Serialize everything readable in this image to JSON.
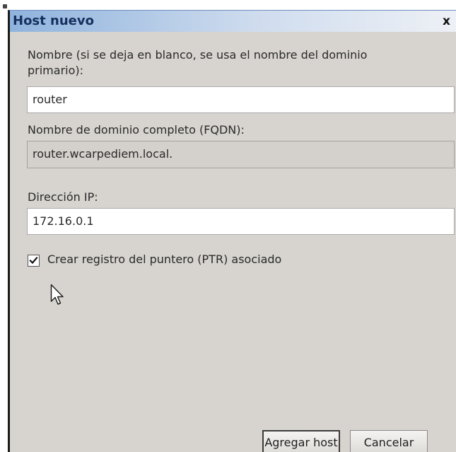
{
  "dialog": {
    "title": "Host nuevo",
    "close_label": "x"
  },
  "form": {
    "name_label": "Nombre (si se deja en blanco, se usa el nombre del dominio primario):",
    "name_label_line1": "Nombre (si se deja en blanco, se usa el nombre del dominio",
    "name_label_line2": "primario):",
    "name_value": "router",
    "fqdn_label": "Nombre de dominio completo (FQDN):",
    "fqdn_value": "router.wcarpediem.local.",
    "ip_label": "Dirección IP:",
    "ip_value": "172.16.0.1",
    "ptr_checkbox_label": "Crear registro del puntero (PTR) asociado",
    "ptr_checked": true
  },
  "buttons": {
    "add_host": "Agregar host",
    "cancel": "Cancelar"
  },
  "icons": {
    "close": "close-icon",
    "check": "checkmark-icon",
    "cursor": "mouse-pointer-icon"
  }
}
